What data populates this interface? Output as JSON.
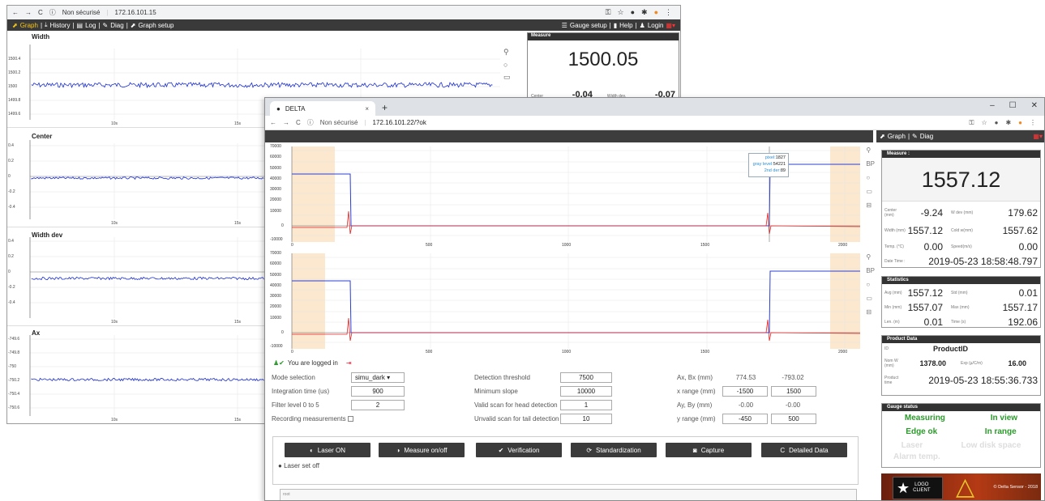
{
  "back": {
    "tab_insecure": "Non sécurisé",
    "url": "172.16.101.15",
    "nav": {
      "graph": "Graph",
      "history": "History",
      "log": "Log",
      "diag": "Diag",
      "setup": "Graph setup",
      "gauge": "Gauge setup",
      "help": "Help",
      "login": "Login"
    },
    "plots": [
      {
        "title": "Width",
        "yticks": [
          "1500.4",
          "1500.2",
          "1500",
          "1499.8",
          "1499.6"
        ],
        "xticks": [
          "10s",
          "15s"
        ]
      },
      {
        "title": "Center",
        "yticks": [
          "0.4",
          "0.2",
          "0",
          "-0.2",
          "-0.4"
        ],
        "xticks": [
          "10s",
          "15s"
        ]
      },
      {
        "title": "Width dev",
        "yticks": [
          "0.4",
          "0.2",
          "0",
          "-0.2",
          "-0.4"
        ],
        "xticks": [
          "10s",
          "15s"
        ]
      },
      {
        "title": "Ax",
        "yticks": [
          "-749.6",
          "-749.8",
          "-750",
          "-750.2",
          "-750.4",
          "-750.6"
        ],
        "xticks": [
          "10s",
          "15s"
        ]
      }
    ],
    "measure": {
      "head": "Measure",
      "value": "1500.05",
      "center_l": "Center",
      "center": "-0.04",
      "wdev_l": "Width dev.",
      "wdev": "-0.07"
    }
  },
  "front": {
    "tab_title": "DELTA",
    "insecure": "Non sécurisé",
    "url": "172.16.101.22/?ok",
    "side_nav": {
      "graph": "Graph",
      "diag": "Diag"
    },
    "measure": {
      "head": "Measure :",
      "value": "1557.12",
      "cells": [
        {
          "l": "Center (mm)",
          "v": "-9.24",
          "l2": "W dev (mm)",
          "v2": "179.62"
        },
        {
          "l": "Width (mm)",
          "v": "1557.12",
          "l2": "Cold w(mm)",
          "v2": "1557.62"
        },
        {
          "l": "Temp. (°C)",
          "v": "0.00",
          "l2": "Speed(m/s)",
          "v2": "0.00"
        }
      ],
      "dt_l": "Date Time :",
      "dt": "2019-05-23 18:58:48.797"
    },
    "stats": {
      "head": "Statistics",
      "cells": [
        {
          "l": "Avg (mm)",
          "v": "1557.12",
          "l2": "Std (mm)",
          "v2": "0.01"
        },
        {
          "l": "Min (mm)",
          "v": "1557.07",
          "l2": "Max (mm)",
          "v2": "1557.17"
        },
        {
          "l": "Len. (m)",
          "v": "0.01",
          "l2": "Time (s)",
          "v2": "192.06"
        }
      ]
    },
    "product": {
      "head": "Product Data",
      "id_l": "ID",
      "id": "ProductID",
      "nom_l": "Nom W (mm)",
      "nom": "1378.00",
      "exp_l": "Exp (µ/C/m)",
      "exp": "16.00",
      "time_l": "Product time",
      "time": "2019-05-23 18:55:36.733"
    },
    "gauge": {
      "head": "Gauge status",
      "s1": "Measuring",
      "s2": "In view",
      "s3": "Edge ok",
      "s4": "In range",
      "s5": "Laser",
      "s6": "Low disk space",
      "s7": "Alarm temp."
    },
    "logo": {
      "l1": "LOGO",
      "l2": "CLIENT",
      "copy": "© Delta Sensor - 2018"
    },
    "plot_y": [
      "70000",
      "60000",
      "50000",
      "40000",
      "30000",
      "20000",
      "10000",
      "0",
      "-10000"
    ],
    "plot_x": [
      "0",
      "500",
      "1000",
      "1500",
      "2000"
    ],
    "tooltip": {
      "pixel_l": "pixel:",
      "pixel": "1827",
      "gray_l": "gray level:",
      "gray": "54221",
      "der_l": "2nd der:",
      "der": "89"
    },
    "logged": "You are logged in",
    "form": {
      "mode_l": "Mode selection",
      "mode": "simu_dark",
      "int_l": "Integration time (us)",
      "int": "900",
      "filter_l": "Filter level 0 to 5",
      "filter": "2",
      "rec_l": "Recording measurements",
      "det_l": "Detection threshold",
      "det": "7500",
      "slope_l": "Minimum slope",
      "slope": "10000",
      "head_l": "Valid scan for head detection",
      "head": "1",
      "tail_l": "Unvalid scan for tail detection",
      "tail": "10",
      "axbx_l": "Ax, Bx (mm)",
      "ax": "774.53",
      "bx": "-793.02",
      "xr_l": "x range (mm)",
      "xr1": "-1500",
      "xr2": "1500",
      "ayby_l": "Ay, By (mm)",
      "ay": "-0.00",
      "by": "-0.00",
      "yr_l": "y range (mm)",
      "yr1": "-450",
      "yr2": "500"
    },
    "buttons": [
      "Laser ON",
      "Measure on/off",
      "Verification",
      "Standardization",
      "Capture",
      "Detailed Data"
    ],
    "laser_status": "Laser set off",
    "log_label": "root"
  }
}
